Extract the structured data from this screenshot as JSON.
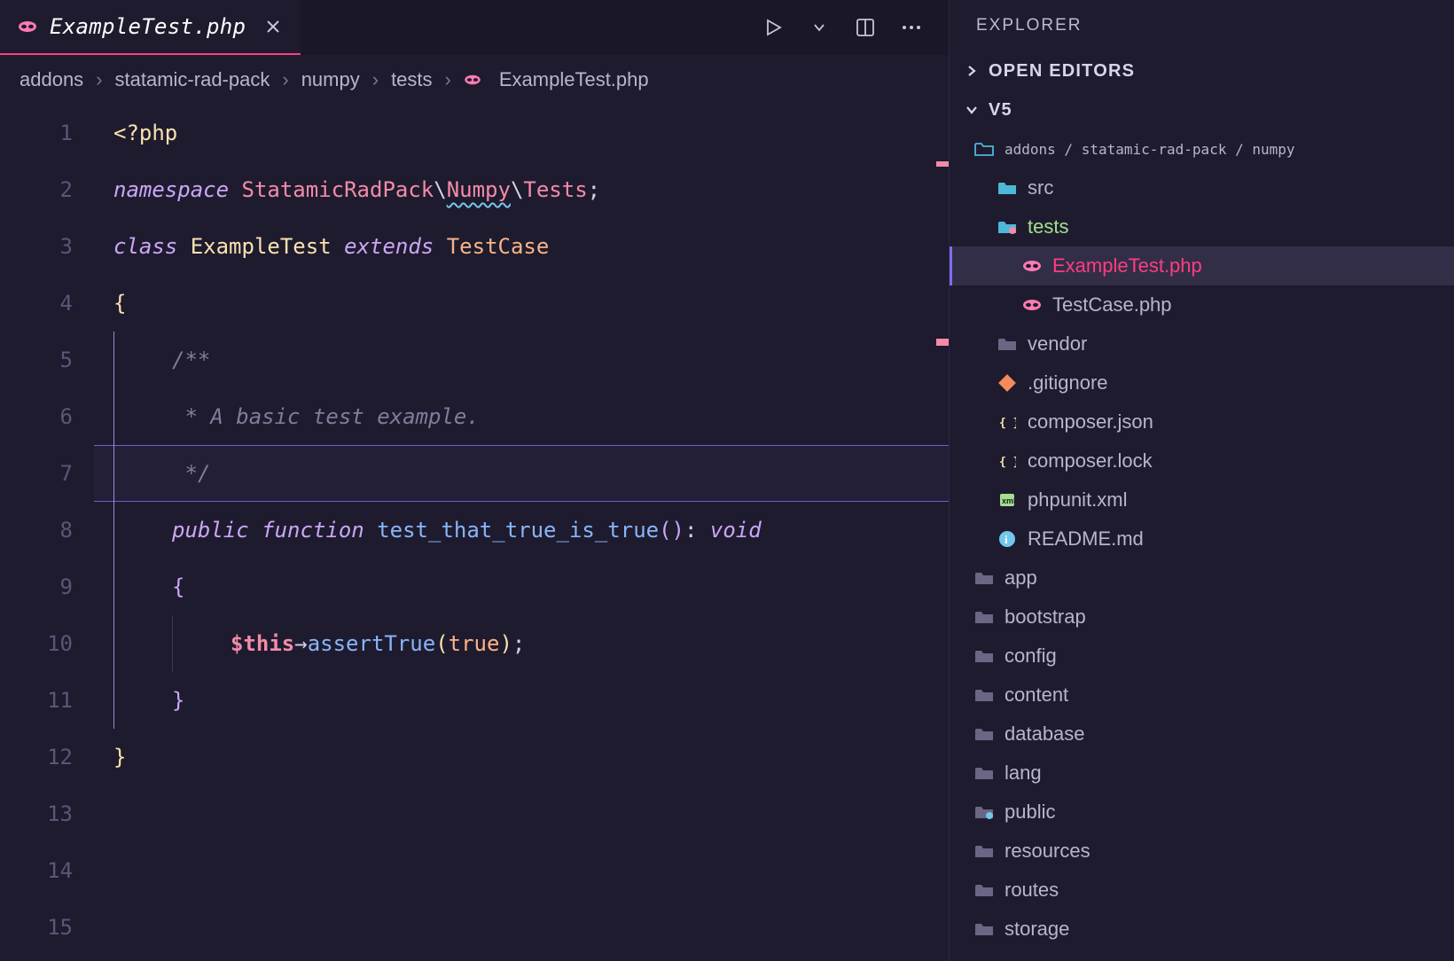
{
  "tab": {
    "filename": "ExampleTest.php"
  },
  "breadcrumb": {
    "parts": [
      "addons",
      "statamic-rad-pack",
      "numpy",
      "tests"
    ],
    "file": "ExampleTest.php"
  },
  "editor": {
    "highlighted_line": 7,
    "lines": [
      {
        "n": 1,
        "tokens": [
          [
            "tk-php-open",
            "<?php"
          ]
        ]
      },
      {
        "n": 2,
        "tokens": []
      },
      {
        "n": 3,
        "tokens": [
          [
            "tk-keyword",
            "namespace"
          ],
          [
            "",
            " "
          ],
          [
            "tk-ns",
            "StatamicRadPack"
          ],
          [
            "tk-punct",
            "\\"
          ],
          [
            "tk-ns tk-squiggle",
            "Numpy"
          ],
          [
            "tk-punct",
            "\\"
          ],
          [
            "tk-ns",
            "Tests"
          ],
          [
            "tk-punct",
            ";"
          ]
        ]
      },
      {
        "n": 4,
        "tokens": []
      },
      {
        "n": 5,
        "tokens": [
          [
            "tk-keyword",
            "class"
          ],
          [
            "",
            " "
          ],
          [
            "tk-class",
            "ExampleTest"
          ],
          [
            "",
            " "
          ],
          [
            "tk-ext",
            "extends"
          ],
          [
            "",
            " "
          ],
          [
            "tk-testcase",
            "TestCase"
          ]
        ]
      },
      {
        "n": 6,
        "tokens": [
          [
            "tk-brace",
            "{"
          ]
        ]
      },
      {
        "n": 7,
        "indent": 1,
        "tokens": [
          [
            "tk-comment",
            "/**"
          ]
        ]
      },
      {
        "n": 8,
        "indent": 1,
        "tokens": [
          [
            "tk-comment",
            " * A basic test example."
          ]
        ]
      },
      {
        "n": 9,
        "indent": 1,
        "tokens": [
          [
            "tk-comment",
            " */"
          ]
        ]
      },
      {
        "n": 10,
        "indent": 1,
        "tokens": [
          [
            "tk-keyword",
            "public"
          ],
          [
            "",
            " "
          ],
          [
            "tk-keyword",
            "function"
          ],
          [
            "",
            " "
          ],
          [
            "tk-fnname",
            "test_that_true_is_true"
          ],
          [
            "tk-paren",
            "("
          ],
          [
            "tk-paren",
            ")"
          ],
          [
            "tk-punct",
            ": "
          ],
          [
            "tk-type",
            "void"
          ]
        ]
      },
      {
        "n": 11,
        "indent": 1,
        "tokens": [
          [
            "tk-paren",
            "{"
          ]
        ]
      },
      {
        "n": 12,
        "indent": 2,
        "tokens": [
          [
            "tk-var",
            "$this"
          ],
          [
            "tk-arrow",
            "→"
          ],
          [
            "tk-func",
            "assertTrue"
          ],
          [
            "tk-paren2",
            "("
          ],
          [
            "tk-bool",
            "true"
          ],
          [
            "tk-paren2",
            ")"
          ],
          [
            "tk-punct",
            ";"
          ]
        ]
      },
      {
        "n": 13,
        "indent": 1,
        "tokens": [
          [
            "tk-paren",
            "}"
          ]
        ]
      },
      {
        "n": 14,
        "tokens": [
          [
            "tk-brace",
            "}"
          ]
        ]
      },
      {
        "n": 15,
        "tokens": []
      }
    ]
  },
  "sidebar": {
    "panel": "EXPLORER",
    "sections": {
      "open_editors": "OPEN EDITORS",
      "project": "V5"
    },
    "path_header": "addons / statamic-rad-pack / numpy",
    "tree": [
      {
        "depth": 1,
        "icon": "folder-src",
        "label": "src",
        "color": "#b8b4cc"
      },
      {
        "depth": 1,
        "icon": "folder-tests",
        "label": "tests",
        "color": "#a4e08c"
      },
      {
        "depth": 2,
        "icon": "php",
        "label": "ExampleTest.php",
        "selected": true
      },
      {
        "depth": 2,
        "icon": "php",
        "label": "TestCase.php"
      },
      {
        "depth": 1,
        "icon": "folder",
        "label": "vendor"
      },
      {
        "depth": 1,
        "icon": "git",
        "label": ".gitignore"
      },
      {
        "depth": 1,
        "icon": "json",
        "label": "composer.json"
      },
      {
        "depth": 1,
        "icon": "json",
        "label": "composer.lock"
      },
      {
        "depth": 1,
        "icon": "xml",
        "label": "phpunit.xml"
      },
      {
        "depth": 1,
        "icon": "readme",
        "label": "README.md"
      },
      {
        "depth": 0,
        "icon": "folder",
        "label": "app"
      },
      {
        "depth": 0,
        "icon": "folder",
        "label": "bootstrap"
      },
      {
        "depth": 0,
        "icon": "folder",
        "label": "config"
      },
      {
        "depth": 0,
        "icon": "folder",
        "label": "content"
      },
      {
        "depth": 0,
        "icon": "folder",
        "label": "database"
      },
      {
        "depth": 0,
        "icon": "folder",
        "label": "lang"
      },
      {
        "depth": 0,
        "icon": "folder-public",
        "label": "public"
      },
      {
        "depth": 0,
        "icon": "folder",
        "label": "resources"
      },
      {
        "depth": 0,
        "icon": "folder",
        "label": "routes"
      },
      {
        "depth": 0,
        "icon": "folder",
        "label": "storage"
      }
    ]
  }
}
